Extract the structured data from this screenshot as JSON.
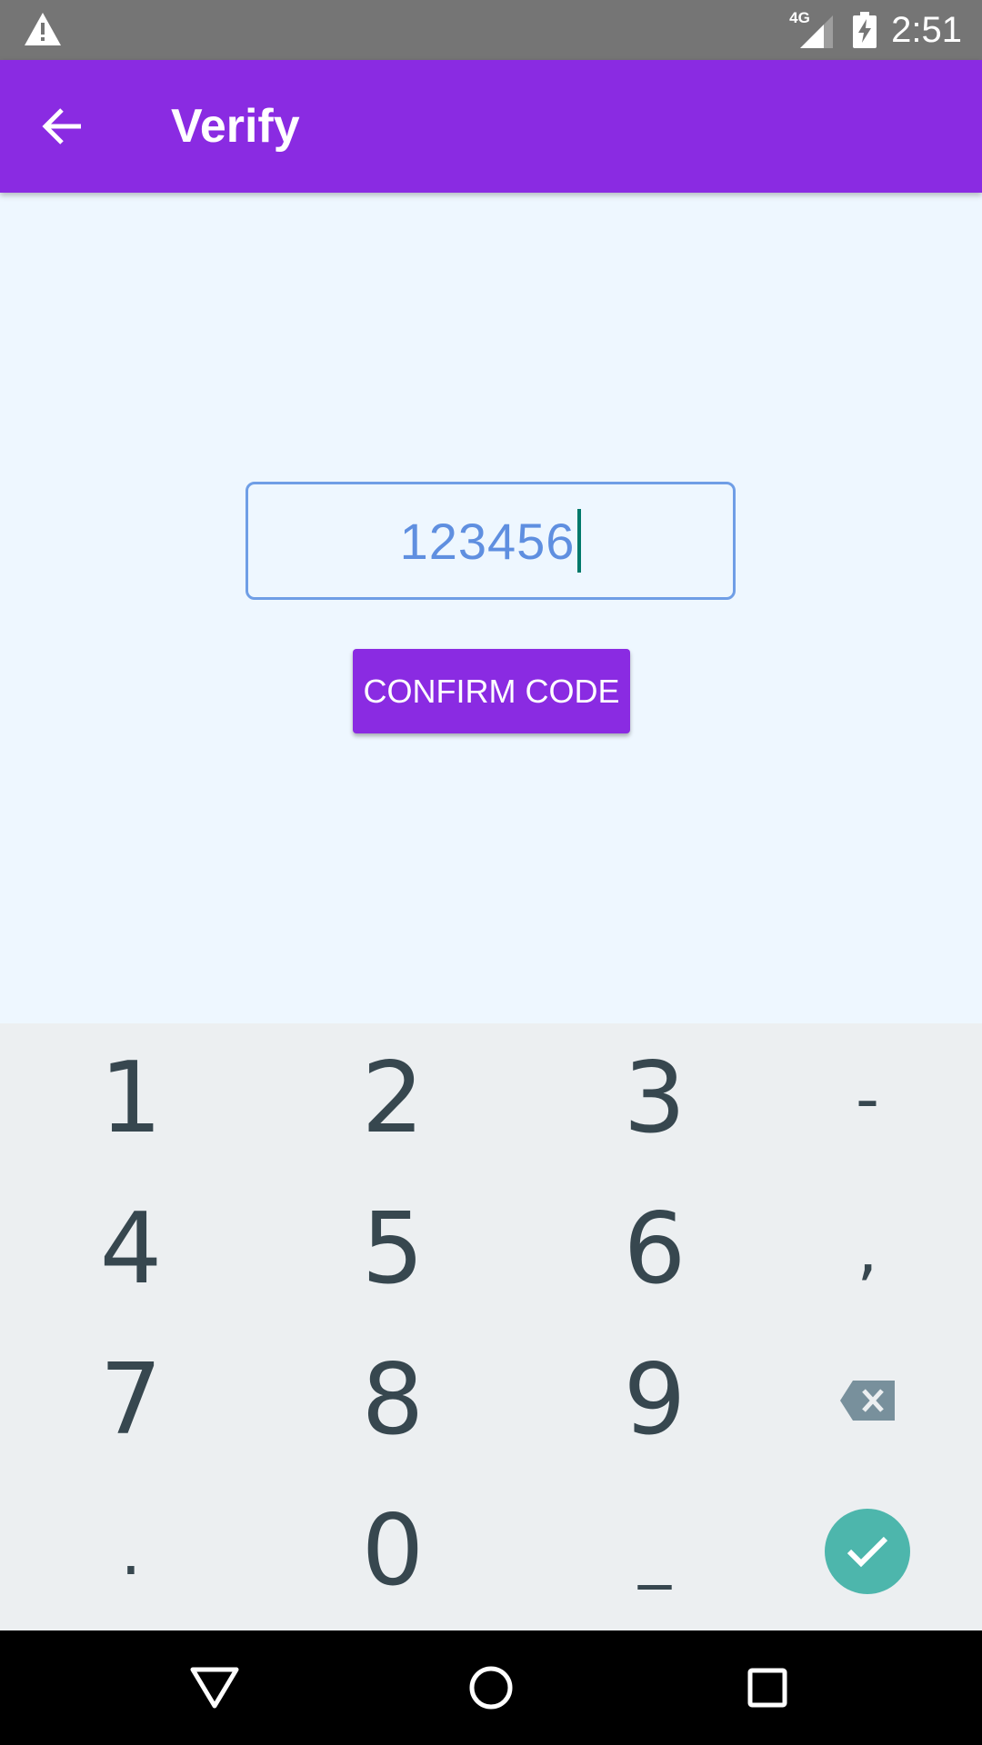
{
  "status_bar": {
    "network_label": "4G",
    "time": "2:51",
    "icons": [
      "warning-icon",
      "signal-icon",
      "battery-charging-icon"
    ]
  },
  "toolbar": {
    "back_icon": "arrow-left-icon",
    "title": "Verify",
    "color": "#8a2be2"
  },
  "code_input": {
    "value": "123456",
    "border_color": "#6f9ee6"
  },
  "confirm_button": {
    "label": "CONFIRM CODE"
  },
  "keyboard": {
    "rows": [
      [
        "1",
        "2",
        "3",
        "-"
      ],
      [
        "4",
        "5",
        "6",
        ","
      ],
      [
        "7",
        "8",
        "9",
        "backspace-icon"
      ],
      [
        ".",
        "0",
        "_",
        "check-icon"
      ]
    ],
    "enter_color": "#4db6ac"
  },
  "nav_bar": {
    "icons": [
      "back-triangle-icon",
      "home-circle-icon",
      "recents-square-icon"
    ]
  }
}
